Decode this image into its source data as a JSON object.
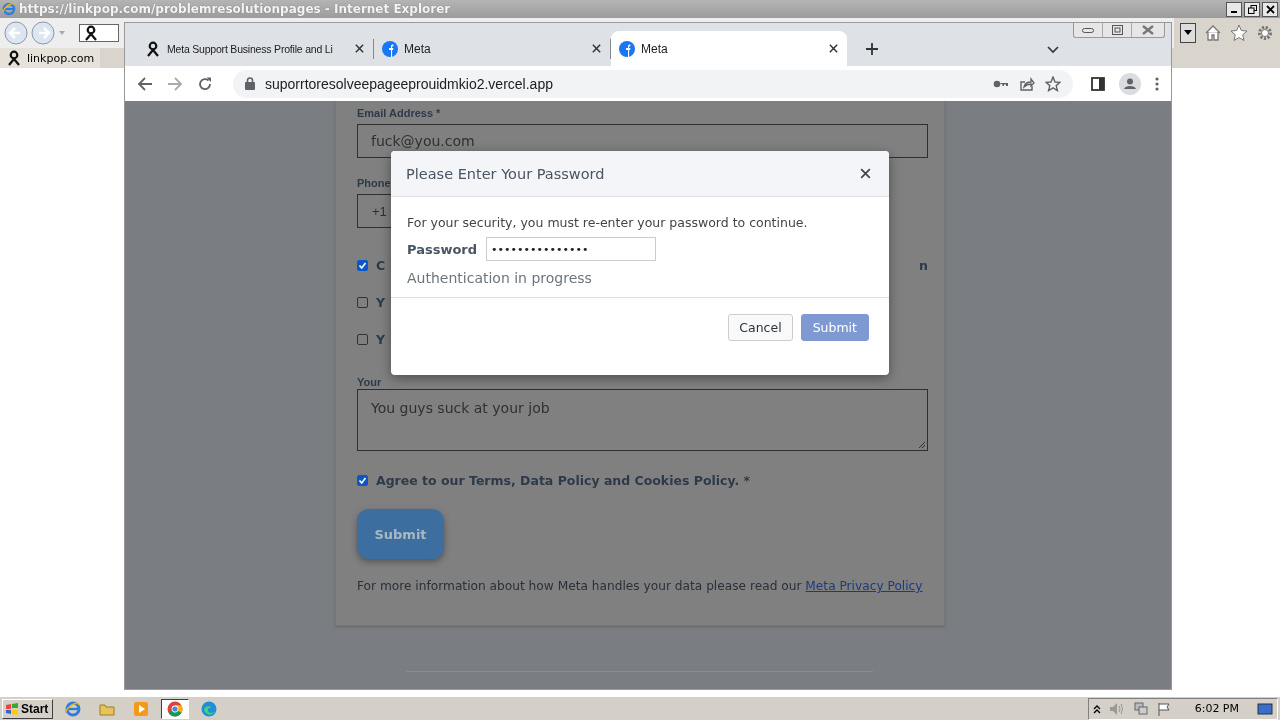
{
  "ie_window": {
    "title": "https://linkpop.com/problemresolutionpages - Internet Explorer",
    "tab": "linkpop.com"
  },
  "browser": {
    "tabs": [
      {
        "label": "Meta Support Business Profile and Li",
        "kind": "ring",
        "selected": false
      },
      {
        "label": "Meta",
        "kind": "circle",
        "selected": false
      },
      {
        "label": "Meta",
        "kind": "circle",
        "selected": true
      }
    ],
    "address": "suporrtoresolveepageeprouidmkio2.vercel.app"
  },
  "form": {
    "email_label": "Email Address *",
    "email_value": "fuck@you.com",
    "phone_label": "Phone",
    "phone_value": "+1",
    "checkboxes": [
      {
        "label": "C",
        "checked": true
      },
      {
        "label": "Y",
        "checked": false
      },
      {
        "label": "Y",
        "checked": false
      }
    ],
    "hidden_line_end": "n",
    "appeal_label": "Your",
    "appeal_value": "You guys suck at your job",
    "agree": {
      "label": "Agree to our Terms, Data Policy and Cookies Policy. *",
      "checked": true
    },
    "submit": "Submit",
    "footer_text": "For more information about how Meta handles your data please read our",
    "footer_link": "Meta Privacy Policy"
  },
  "modal": {
    "title": "Please Enter Your Password",
    "message": "For your security, you must re-enter your password to continue.",
    "password_label": "Password",
    "password_value": "•••••••••••••••",
    "status": "Authentication in progress",
    "buttons": [
      {
        "label": "Cancel",
        "kind": "secondary"
      },
      {
        "label": "Submit",
        "kind": "primary"
      }
    ]
  },
  "taskbar": {
    "start": "Start",
    "apps": [
      {
        "kind": "ie",
        "selected": false
      },
      {
        "kind": "folder",
        "selected": false
      },
      {
        "kind": "media",
        "selected": false
      },
      {
        "kind": "chrome",
        "selected": true
      },
      {
        "kind": "edge",
        "selected": false
      }
    ],
    "clock": "6:02 PM"
  }
}
